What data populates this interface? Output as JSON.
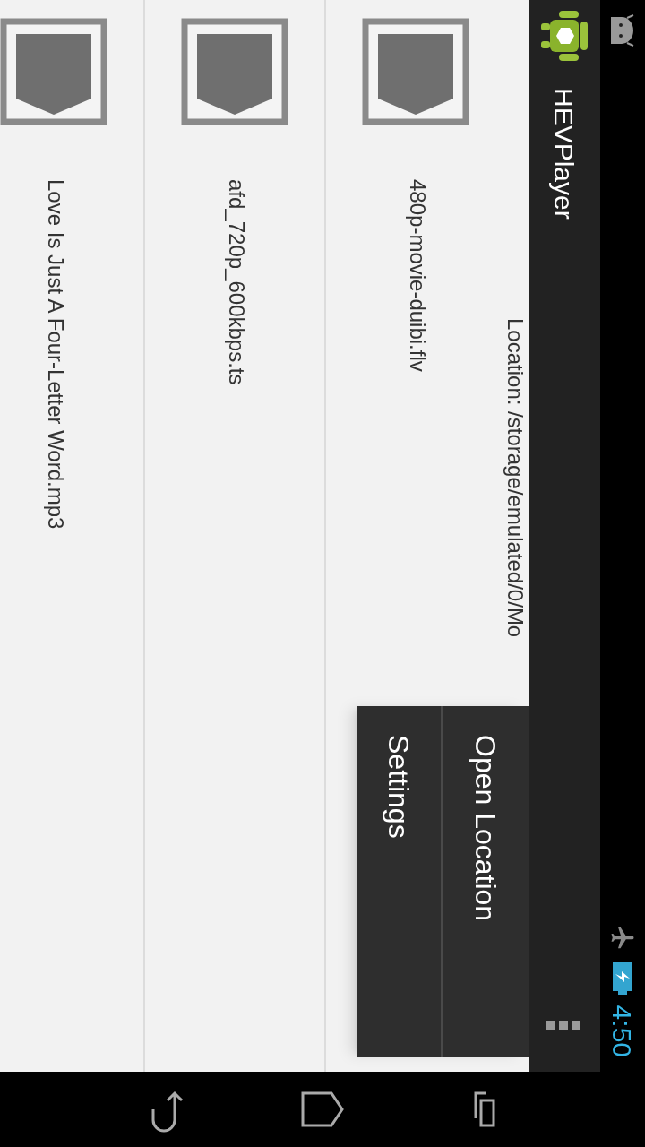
{
  "status_bar": {
    "time": "4:50"
  },
  "action_bar": {
    "title": "HEVPlayer"
  },
  "location": "Location: /storage/emulated/0/Mo",
  "files": [
    {
      "name": "480p-movie-duibi.flv"
    },
    {
      "name": "afd_720p_600kbps.ts"
    },
    {
      "name": "Love Is Just A Four-Letter Word.mp3"
    }
  ],
  "menu": {
    "items": [
      {
        "label": "Open Location"
      },
      {
        "label": "Settings"
      }
    ]
  }
}
